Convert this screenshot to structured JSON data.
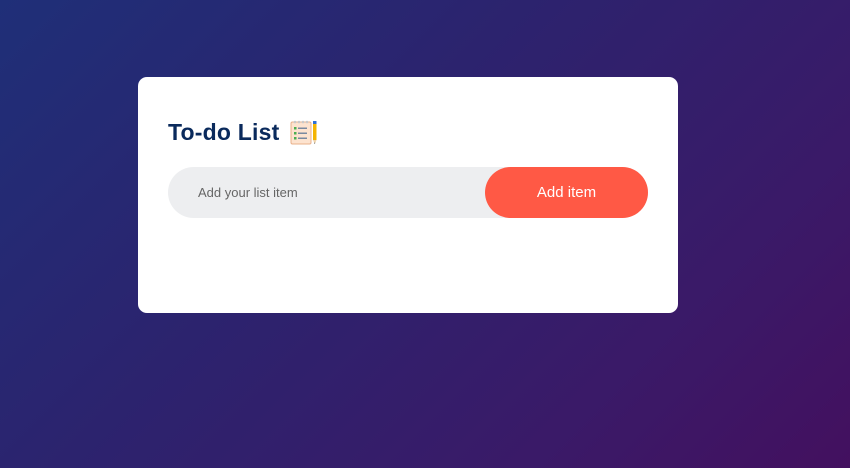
{
  "app": {
    "title": "To-do List",
    "title_icon": "notepad-checklist-icon"
  },
  "form": {
    "input_placeholder": "Add your list item",
    "input_value": "",
    "add_button_label": "Add item"
  },
  "list": {
    "items": []
  },
  "colors": {
    "accent": "#ff5945",
    "title": "#0a2a5c",
    "input_background": "#edeef0",
    "background_start": "#1f2f78",
    "background_end": "#43105f"
  }
}
